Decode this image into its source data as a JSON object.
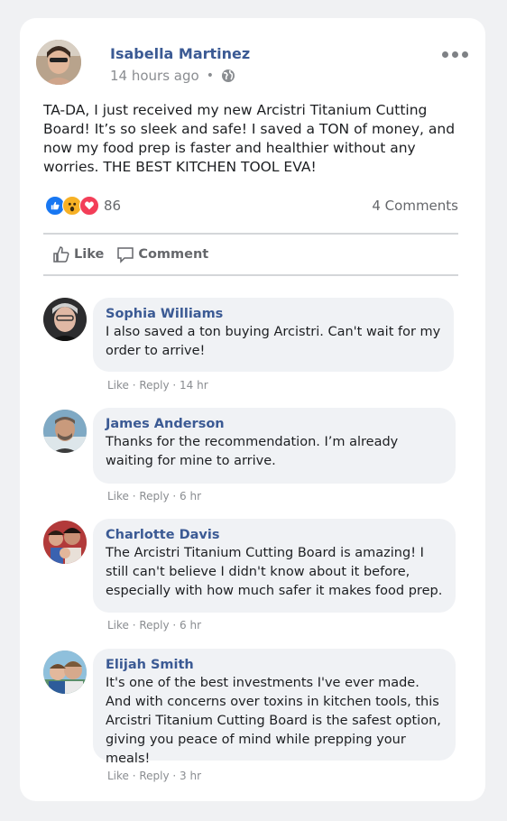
{
  "post": {
    "author": "Isabella Martinez",
    "time": "14 hours ago",
    "separator": "•",
    "text": "TA-DA, I just received my new Arcistri Titanium Cutting Board! It’s so sleek and safe! I saved a TON of money, and now my food prep is faster and healthier without any worries. THE BEST KITCHEN TOOL EVA!",
    "reaction_count": "86",
    "comments_count": "4 Comments",
    "like_label": "Like",
    "comment_label": "Comment",
    "reaction_icons": [
      "like-icon",
      "wow-icon",
      "love-icon"
    ],
    "colors": {
      "name": "#3b5a94",
      "like": "#1877f2",
      "love": "#f33e58",
      "wow": "#f7b125"
    }
  },
  "comments": [
    {
      "name": "Sophia Williams",
      "text": "I also saved a ton buying Arcistri. Can't wait for my order to arrive!",
      "footer": "Like · Reply · 14 hr"
    },
    {
      "name": "James Anderson",
      "text": "Thanks for the recommendation. I’m already waiting for mine to arrive.",
      "footer": "Like · Reply · 6 hr"
    },
    {
      "name": "Charlotte Davis",
      "text": "The Arcistri Titanium Cutting Board is amazing! I still can't believe I didn't know about it before, especially with how much safer it makes food prep.",
      "footer": "Like · Reply · 6 hr"
    },
    {
      "name": "Elijah Smith",
      "text": "It's one of the best investments I've ever made. And with concerns over toxins in kitchen tools, this Arcistri Titanium Cutting Board is the safest option, giving you peace of mind while prepping your meals!",
      "footer": "Like · Reply · 3 hr"
    }
  ]
}
